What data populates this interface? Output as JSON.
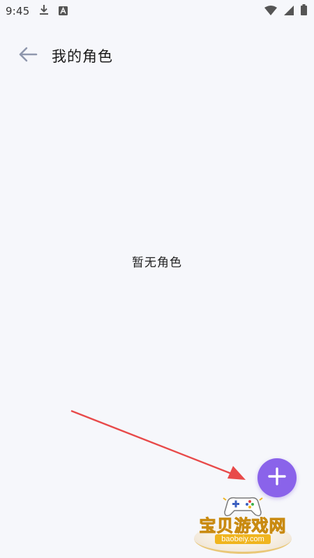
{
  "status_bar": {
    "time": "9:45",
    "left_icons": [
      "download-icon",
      "app-a-icon"
    ],
    "right_icons": [
      "wifi-icon",
      "signal-icon",
      "battery-icon"
    ]
  },
  "app_bar": {
    "back_icon": "arrow-left-icon",
    "title": "我的角色"
  },
  "main": {
    "empty_text": "暂无角色"
  },
  "fab": {
    "icon": "plus-icon",
    "color": "#8a63ea"
  },
  "annotation": {
    "arrow_color": "#e84a4a"
  },
  "watermark": {
    "name": "宝贝游戏网",
    "url": "baobeiy.com"
  }
}
